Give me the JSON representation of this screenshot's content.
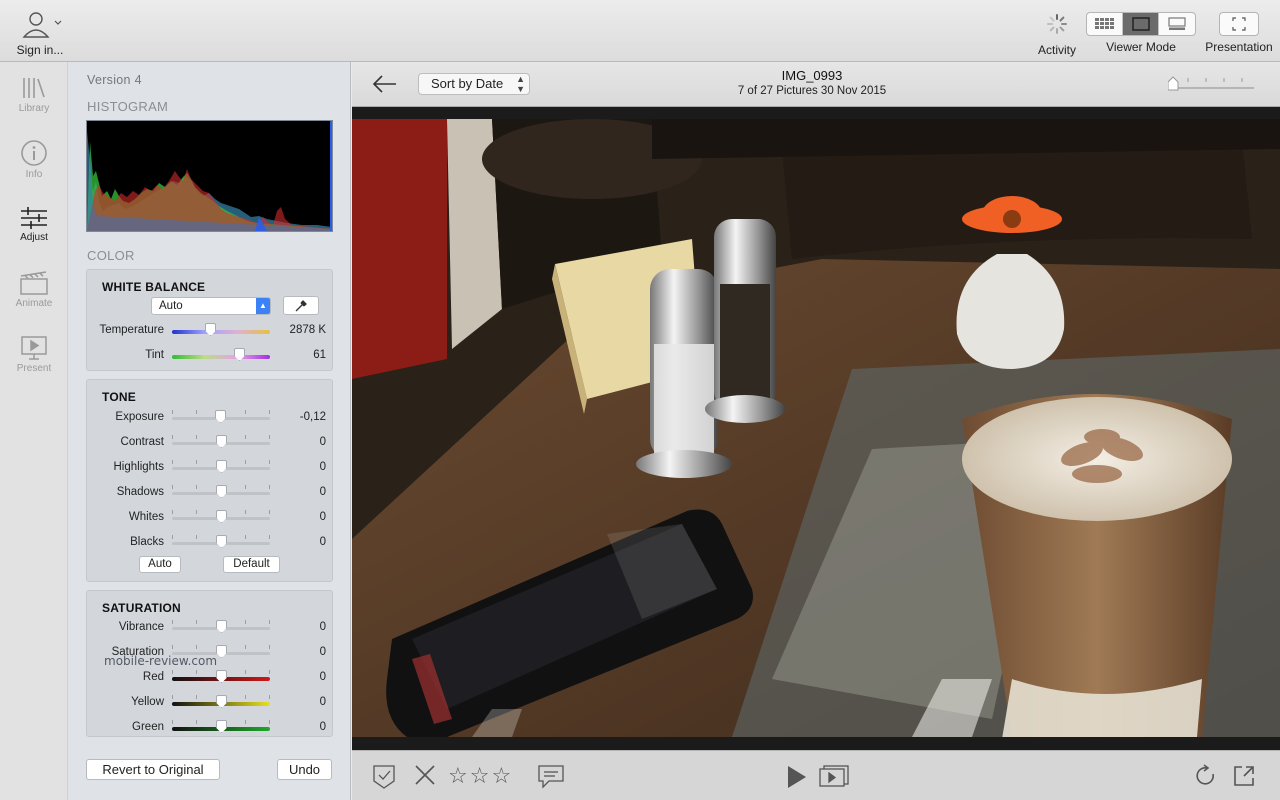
{
  "toolbar": {
    "signin_label": "Sign in...",
    "activity_label": "Activity",
    "viewer_mode_label": "Viewer Mode",
    "presentation_label": "Presentation"
  },
  "rail": {
    "items": [
      {
        "label": "Library",
        "icon": "library-icon"
      },
      {
        "label": "Info",
        "icon": "info-icon"
      },
      {
        "label": "Adjust",
        "icon": "adjust-icon",
        "active": true
      },
      {
        "label": "Animate",
        "icon": "animate-icon"
      },
      {
        "label": "Present",
        "icon": "present-icon"
      }
    ]
  },
  "panel": {
    "version": "Version 4",
    "histogram_title": "HISTOGRAM",
    "color_title": "COLOR",
    "white_balance": {
      "title": "WHITE BALANCE",
      "mode": "Auto",
      "temperature": {
        "label": "Temperature",
        "value": "2878 K",
        "level": 0.4
      },
      "tint": {
        "label": "Tint",
        "value": "61",
        "level": 0.7
      }
    },
    "tone": {
      "title": "TONE",
      "rows": [
        {
          "label": "Exposure",
          "value": "-0,12",
          "level": 0.49
        },
        {
          "label": "Contrast",
          "value": "0",
          "level": 0.5
        },
        {
          "label": "Highlights",
          "value": "0",
          "level": 0.5
        },
        {
          "label": "Shadows",
          "value": "0",
          "level": 0.5
        },
        {
          "label": "Whites",
          "value": "0",
          "level": 0.5
        },
        {
          "label": "Blacks",
          "value": "0",
          "level": 0.5
        }
      ],
      "auto_label": "Auto",
      "default_label": "Default"
    },
    "saturation": {
      "title": "SATURATION",
      "rows": [
        {
          "label": "Vibrance",
          "value": "0",
          "level": 0.5
        },
        {
          "label": "Saturation",
          "value": "0",
          "level": 0.5
        },
        {
          "label": "Red",
          "value": "0",
          "level": 0.5
        },
        {
          "label": "Yellow",
          "value": "0",
          "level": 0.5
        },
        {
          "label": "Green",
          "value": "0",
          "level": 0.5
        }
      ]
    },
    "revert_label": "Revert to Original",
    "undo_label": "Undo",
    "watermark": "mobile-review.com"
  },
  "viewer": {
    "sort_label": "Sort by Date",
    "image_name": "IMG_0993",
    "subtitle": "7 of 27 Pictures   30 Nov 2015",
    "rating_stars": 3
  },
  "colors": {
    "accent": "#3a82f6",
    "panel_bg": "#dfe3e8"
  }
}
